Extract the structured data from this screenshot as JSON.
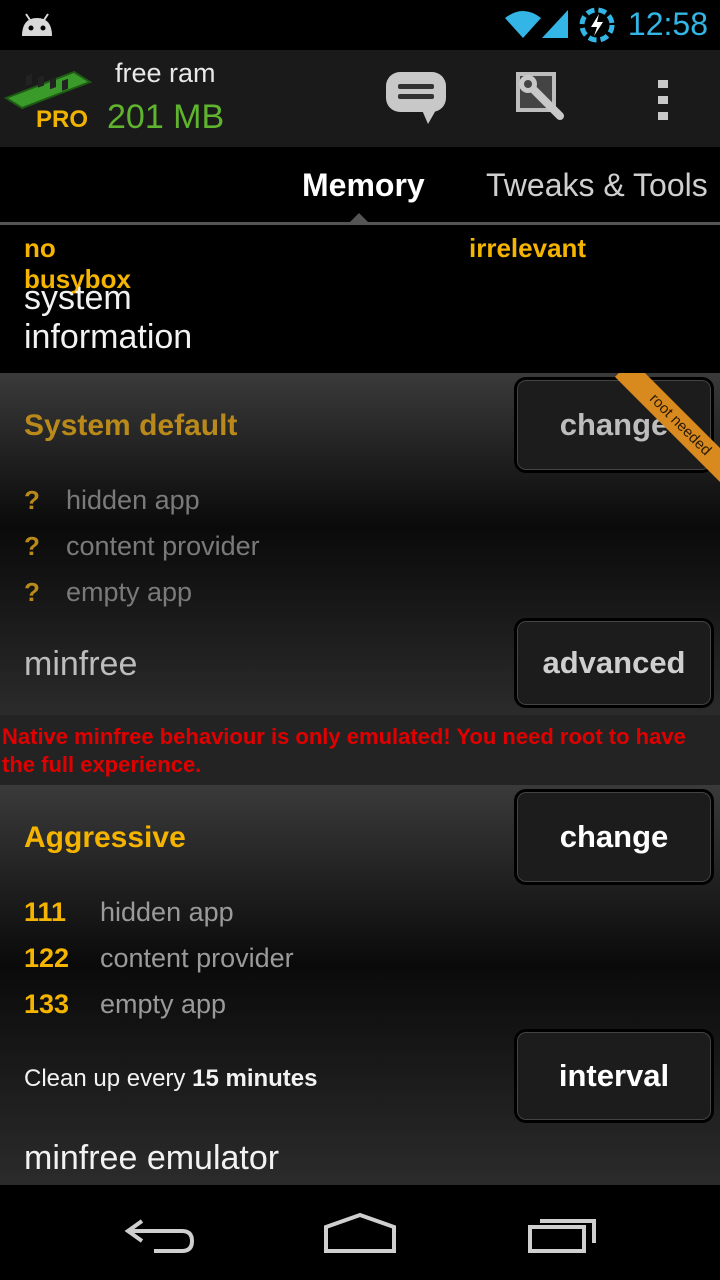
{
  "status_bar": {
    "time": "12:58"
  },
  "header": {
    "free_ram_label": "free ram",
    "free_ram_value": "201 MB",
    "pro_badge": "PRO"
  },
  "tabs": [
    {
      "label": "Memory"
    },
    {
      "label": "Tweaks & Tools"
    }
  ],
  "info": {
    "busybox": "no busybox",
    "status": "irrelevant",
    "title": "system information"
  },
  "system_default": {
    "title": "System default",
    "change_button": "change",
    "ribbon": "root needed",
    "rows": [
      {
        "value": "?",
        "label": "hidden app"
      },
      {
        "value": "?",
        "label": "content provider"
      },
      {
        "value": "?",
        "label": "empty app"
      }
    ],
    "minfree_label": "minfree",
    "advanced_button": "advanced"
  },
  "warning": "Native minfree behaviour is only emulated! You need root to have the full experience.",
  "aggressive": {
    "title": "Aggressive",
    "change_button": "change",
    "rows": [
      {
        "value": "111",
        "label": "hidden app"
      },
      {
        "value": "122",
        "label": "content provider"
      },
      {
        "value": "133",
        "label": "empty app"
      }
    ],
    "cleanup_prefix": "Clean up every",
    "cleanup_value": "15 minutes",
    "interval_button": "interval",
    "emulator_label": "minfree emulator"
  },
  "colors": {
    "accent": "#f4b400",
    "ram": "#5fb32e",
    "clock": "#33b5e5",
    "warning": "#e00000"
  }
}
